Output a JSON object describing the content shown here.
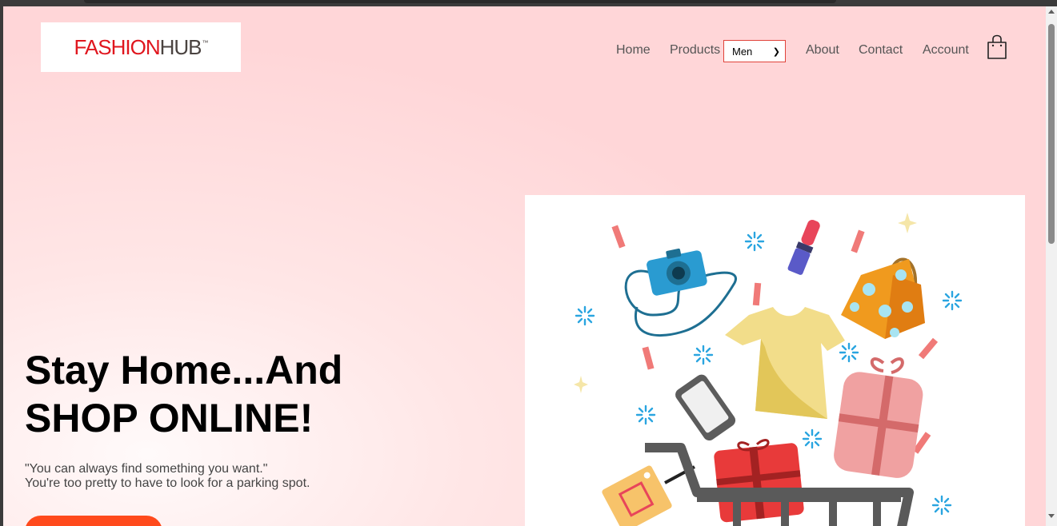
{
  "logo": {
    "part1": "FASHION",
    "part2": "HUB",
    "tm": "™"
  },
  "nav": {
    "home": "Home",
    "products": "Products",
    "category_select": {
      "selected": "Men",
      "options": [
        "Men"
      ]
    },
    "about": "About",
    "contact": "Contact",
    "account": "Account",
    "cart_icon": "shopping-bag-icon"
  },
  "hero": {
    "title_line1": "Stay Home...And",
    "title_line2": "SHOP ONLINE!",
    "subtitle_line1": "\"You can always find something you want.\"",
    "subtitle_line2": "You're too pretty to have to look for a parking spot."
  },
  "colors": {
    "brand_red": "#e0161e",
    "cta_orange": "#ff4a1c",
    "page_pink": "#ffd6d8"
  }
}
